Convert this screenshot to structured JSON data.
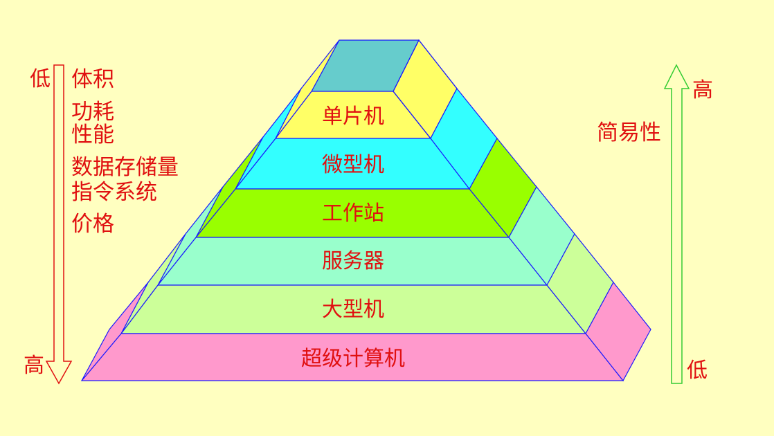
{
  "colors": {
    "background": "#ffffc0",
    "text": "#e01010",
    "edge": "#1a1aff",
    "left_arrow": "#e01010",
    "right_arrow": "#33cc33"
  },
  "pyramid": {
    "levels": [
      {
        "label": "",
        "color": "#66cccc"
      },
      {
        "label": "单片机",
        "color": "#ffff66"
      },
      {
        "label": "微型机",
        "color": "#33ffff"
      },
      {
        "label": "工作站",
        "color": "#99ff00"
      },
      {
        "label": "服务器",
        "color": "#99ffcc"
      },
      {
        "label": "大型机",
        "color": "#ccff99"
      },
      {
        "label": "超级计算机",
        "color": "#ff99cc"
      }
    ]
  },
  "left_scale": {
    "top_label": "低",
    "bottom_label": "高",
    "attributes": [
      "体积",
      "功耗",
      "性能",
      "数据存储量",
      "指令系统",
      "价格"
    ]
  },
  "right_scale": {
    "top_label": "高",
    "bottom_label": "低",
    "attribute": "简易性"
  }
}
